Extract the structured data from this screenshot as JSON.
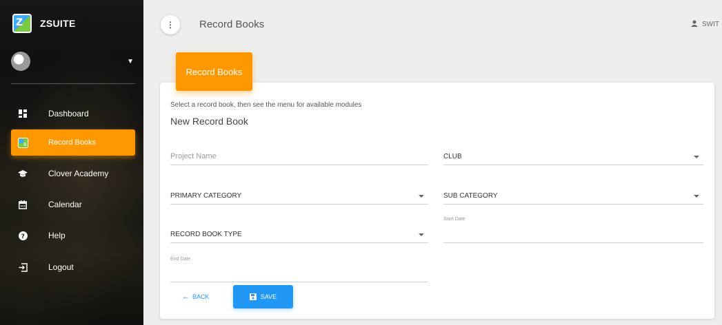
{
  "app": {
    "brand_name": "ZSUITE",
    "logo_text": "Z"
  },
  "sidebar": {
    "items": [
      {
        "label": "Dashboard",
        "icon": "dashboard-icon"
      },
      {
        "label": "Record Books",
        "icon": "record-books-icon",
        "active": true
      },
      {
        "label": "Clover Academy",
        "icon": "graduation-cap-icon"
      },
      {
        "label": "Calendar",
        "icon": "calendar-icon"
      },
      {
        "label": "Help",
        "icon": "help-icon"
      },
      {
        "label": "Logout",
        "icon": "logout-icon"
      }
    ]
  },
  "topbar": {
    "title": "Record Books",
    "switch_label": "SWIT"
  },
  "card": {
    "header": "Record Books",
    "description": "Select a record book, then see the menu for available modules",
    "subtitle": "New Record Book"
  },
  "form": {
    "project_name_placeholder": "Project Name",
    "club_label": "CLUB",
    "primary_category_label": "PRIMARY CATEGORY",
    "sub_category_label": "SUB CATEGORY",
    "start_date_label": "Start Date",
    "record_book_type_label": "RECORD BOOK TYPE",
    "end_date_label": "End Date"
  },
  "actions": {
    "back_label": "BACK",
    "save_label": "SAVE"
  },
  "colors": {
    "accent": "#ff9800",
    "primary": "#2196f3"
  }
}
